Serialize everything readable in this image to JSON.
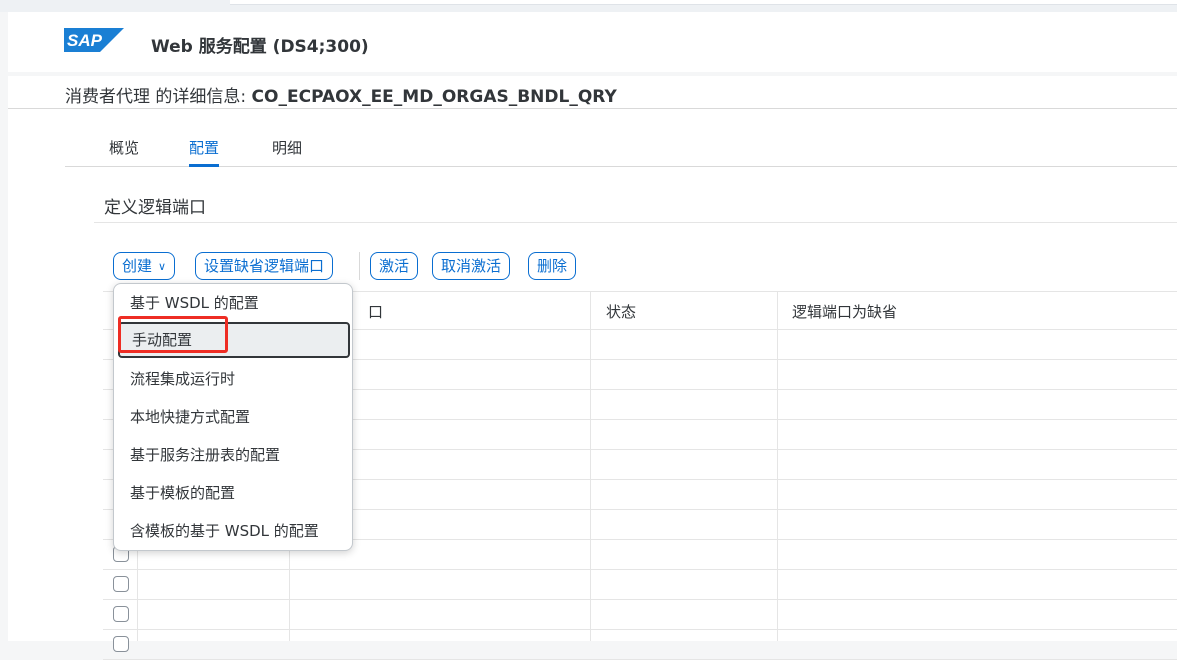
{
  "shell": {
    "title": "Web 服务配置 (DS4;300)",
    "logo_text": "SAP",
    "logo_color": "#1a7fd4"
  },
  "page": {
    "title_prefix": "消费者代理 的详细信息:",
    "object_name": "CO_ECPAOX_EE_MD_ORGAS_BNDL_QRY"
  },
  "tabs": [
    {
      "label": "概览",
      "active": false
    },
    {
      "label": "配置",
      "active": true
    },
    {
      "label": "明细",
      "active": false
    }
  ],
  "section": {
    "title": "定义逻辑端口"
  },
  "toolbar": {
    "create": "创建",
    "set_default": "设置缺省逻辑端口",
    "activate": "激活",
    "deactivate": "取消激活",
    "delete": "删除"
  },
  "table": {
    "columns": [
      "",
      "",
      "口",
      "状态",
      "逻辑端口为缺省"
    ]
  },
  "create_menu": {
    "items": [
      "基于 WSDL 的配置",
      "手动配置",
      "流程集成运行时",
      "本地快捷方式配置",
      "基于服务注册表的配置",
      "基于模板的配置",
      "含模板的基于 WSDL 的配置"
    ],
    "focused_item": "手动配置"
  },
  "colors": {
    "accent": "#0a6ed1",
    "annotation": "#ee2d24"
  }
}
